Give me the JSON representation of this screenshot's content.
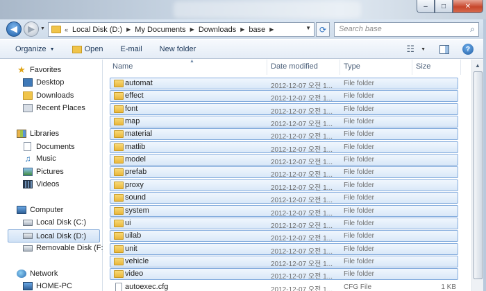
{
  "window": {
    "min_icon": "minimize-icon",
    "max_icon": "maximize-icon",
    "close_icon": "close-icon",
    "min_glyph": "‒",
    "max_glyph": "□",
    "close_glyph": "✕"
  },
  "nav": {
    "back_glyph": "◀",
    "forward_glyph": "▶",
    "dropdown_glyph": "▼",
    "address": {
      "chevron": "«",
      "crumbs": [
        "Local Disk (D:)",
        "My Documents",
        "Downloads",
        "base"
      ],
      "separator": "▶",
      "dropdown_glyph": "▼"
    },
    "refresh_glyph": "⟳",
    "search_placeholder": "Search base",
    "search_glyph": "⌕"
  },
  "toolbar": {
    "organize": "Organize",
    "open": "Open",
    "email": "E-mail",
    "new_folder": "New folder",
    "caret": "▼",
    "view_glyph": "☷",
    "help_glyph": "?"
  },
  "sidebar": {
    "favorites": {
      "label": "Favorites",
      "items": [
        "Desktop",
        "Downloads",
        "Recent Places"
      ]
    },
    "libraries": {
      "label": "Libraries",
      "items": [
        "Documents",
        "Music",
        "Pictures",
        "Videos"
      ]
    },
    "computer": {
      "label": "Computer",
      "items": [
        "Local Disk (C:)",
        "Local Disk (D:)",
        "Removable Disk (F:)"
      ],
      "selected": "Local Disk (D:)"
    },
    "network": {
      "label": "Network",
      "items": [
        "HOME-PC"
      ]
    },
    "star_glyph": "★",
    "music_glyph": "♫"
  },
  "list": {
    "columns": {
      "name": "Name",
      "date": "Date modified",
      "type": "Type",
      "size": "Size"
    },
    "sort_glyph": "▲",
    "rows": [
      {
        "name": "automat",
        "date": "2012-12-07 오전 1...",
        "type": "File folder",
        "size": "",
        "kind": "folder",
        "selected": true
      },
      {
        "name": "effect",
        "date": "2012-12-07 오전 1...",
        "type": "File folder",
        "size": "",
        "kind": "folder",
        "selected": true
      },
      {
        "name": "font",
        "date": "2012-12-07 오전 1...",
        "type": "File folder",
        "size": "",
        "kind": "folder",
        "selected": true
      },
      {
        "name": "map",
        "date": "2012-12-07 오전 1...",
        "type": "File folder",
        "size": "",
        "kind": "folder",
        "selected": true
      },
      {
        "name": "material",
        "date": "2012-12-07 오전 1...",
        "type": "File folder",
        "size": "",
        "kind": "folder",
        "selected": true
      },
      {
        "name": "matlib",
        "date": "2012-12-07 오전 1...",
        "type": "File folder",
        "size": "",
        "kind": "folder",
        "selected": true
      },
      {
        "name": "model",
        "date": "2012-12-07 오전 1...",
        "type": "File folder",
        "size": "",
        "kind": "folder",
        "selected": true
      },
      {
        "name": "prefab",
        "date": "2012-12-07 오전 1...",
        "type": "File folder",
        "size": "",
        "kind": "folder",
        "selected": true
      },
      {
        "name": "proxy",
        "date": "2012-12-07 오전 1...",
        "type": "File folder",
        "size": "",
        "kind": "folder",
        "selected": true
      },
      {
        "name": "sound",
        "date": "2012-12-07 오전 1...",
        "type": "File folder",
        "size": "",
        "kind": "folder",
        "selected": true
      },
      {
        "name": "system",
        "date": "2012-12-07 오전 1...",
        "type": "File folder",
        "size": "",
        "kind": "folder",
        "selected": true
      },
      {
        "name": "ui",
        "date": "2012-12-07 오전 1...",
        "type": "File folder",
        "size": "",
        "kind": "folder",
        "selected": true
      },
      {
        "name": "uilab",
        "date": "2012-12-07 오전 1...",
        "type": "File folder",
        "size": "",
        "kind": "folder",
        "selected": true
      },
      {
        "name": "unit",
        "date": "2012-12-07 오전 1...",
        "type": "File folder",
        "size": "",
        "kind": "folder",
        "selected": true
      },
      {
        "name": "vehicle",
        "date": "2012-12-07 오전 1...",
        "type": "File folder",
        "size": "",
        "kind": "folder",
        "selected": true
      },
      {
        "name": "video",
        "date": "2012-12-07 오전 1...",
        "type": "File folder",
        "size": "",
        "kind": "folder",
        "selected": true
      },
      {
        "name": "autoexec.cfg",
        "date": "2012-12-07 오전 1...",
        "type": "CFG File",
        "size": "1 KB",
        "kind": "file",
        "selected": false
      }
    ]
  },
  "scrollbar": {
    "up_glyph": "▲"
  },
  "colors": {
    "selection_fill": "#d9e8f8",
    "selection_border": "#84acdd",
    "folder": "#f0c44a"
  }
}
